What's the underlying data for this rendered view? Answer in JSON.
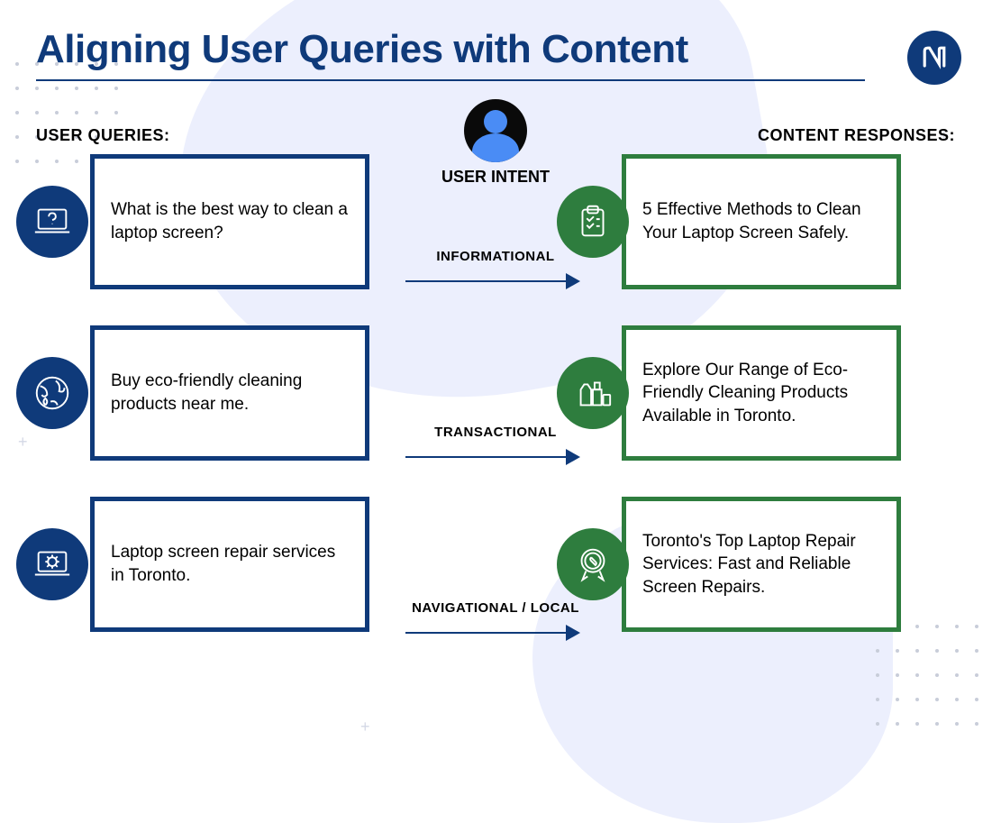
{
  "title": "Aligning User Queries with Content",
  "headings": {
    "left": "USER QUERIES:",
    "mid": "USER INTENT",
    "right": "CONTENT RESPONSES:"
  },
  "rows": [
    {
      "query": "What is the best way to clean a laptop screen?",
      "intent": "INFORMATIONAL",
      "response": "5 Effective Methods to Clean Your Laptop Screen Safely.",
      "query_icon": "laptop-question",
      "response_icon": "checklist"
    },
    {
      "query": "Buy eco-friendly cleaning products near me.",
      "intent": "TRANSACTIONAL",
      "response": "Explore Our Range of Eco-Friendly Cleaning Products Available in Toronto.",
      "query_icon": "globe-eco",
      "response_icon": "products"
    },
    {
      "query": "Laptop screen repair services in Toronto.",
      "intent": "NAVIGATIONAL / LOCAL",
      "response": "Toronto's Top Laptop Repair Services: Fast and Reliable Screen Repairs.",
      "query_icon": "laptop-gear",
      "response_icon": "badge-wrench"
    }
  ],
  "colors": {
    "query": "#0f3a7a",
    "response": "#2e7d3e",
    "bg_blob": "#eceffd"
  }
}
